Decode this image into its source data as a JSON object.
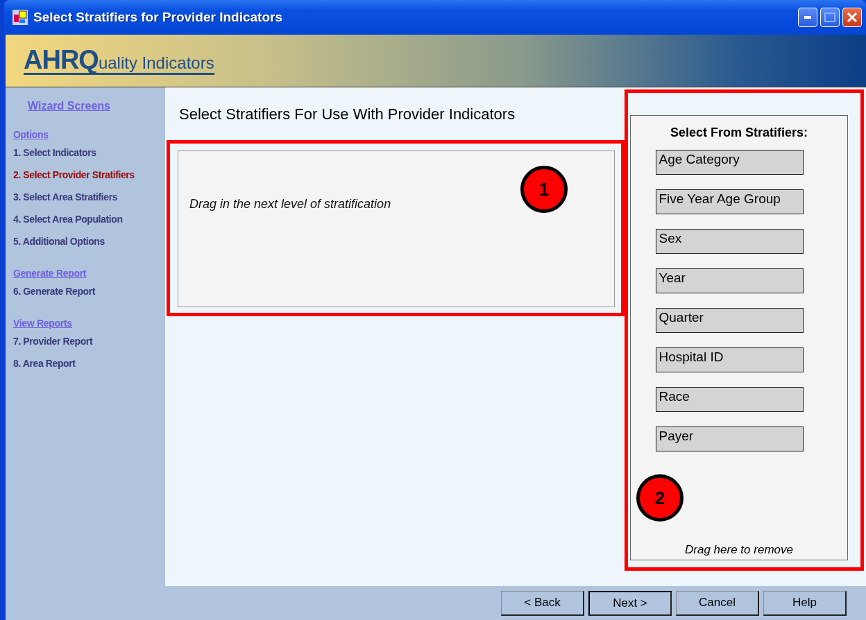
{
  "window": {
    "title": "Select Stratifiers for Provider Indicators"
  },
  "banner": {
    "logo_main": "AHRQ",
    "logo_rest": "uality Indicators"
  },
  "sidebar": {
    "title": "Wizard Screens",
    "sections": [
      {
        "heading": "Options",
        "items": [
          {
            "label": "1. Select Indicators",
            "selected": false
          },
          {
            "label": "2. Select Provider Stratifiers",
            "selected": true
          },
          {
            "label": "3. Select Area Stratifiers",
            "selected": false
          },
          {
            "label": "4. Select Area Population",
            "selected": false
          },
          {
            "label": "5. Additional Options",
            "selected": false
          }
        ]
      },
      {
        "heading": "Generate Report",
        "items": [
          {
            "label": "6. Generate Report",
            "selected": false
          }
        ]
      },
      {
        "heading": "View Reports",
        "items": [
          {
            "label": "7. Provider Report",
            "selected": false
          },
          {
            "label": "8. Area Report",
            "selected": false
          }
        ]
      }
    ]
  },
  "main": {
    "heading": "Select Stratifiers For Use With Provider Indicators",
    "drop_zone": {
      "hint": "Drag in the next level of stratification",
      "callout": "1"
    }
  },
  "stratifiers": {
    "title": "Select From Stratifiers:",
    "items": [
      "Age Category",
      "Five Year Age Group",
      "Sex",
      "Year",
      "Quarter",
      "Hospital ID",
      "Race",
      "Payer"
    ],
    "callout": "2",
    "remove_hint": "Drag here to remove"
  },
  "buttons": [
    {
      "label": "< Back",
      "default": false
    },
    {
      "label": "Next >",
      "default": true
    },
    {
      "label": "Cancel",
      "default": false
    },
    {
      "label": "Help",
      "default": false
    }
  ]
}
